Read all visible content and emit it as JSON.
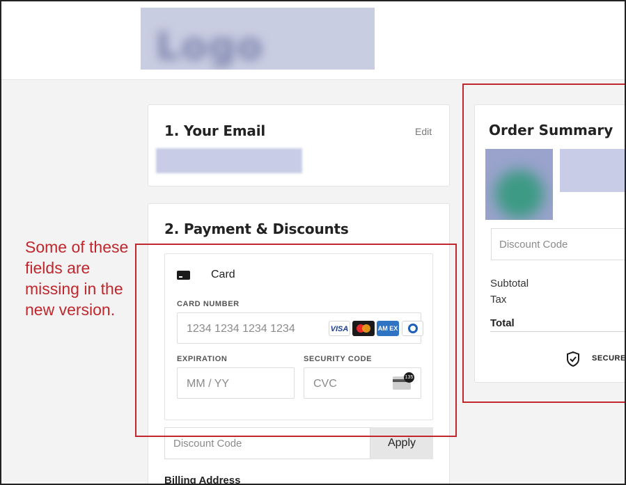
{
  "logo": {
    "text": "Logo"
  },
  "email_section": {
    "title": "1.  Your Email",
    "edit_label": "Edit"
  },
  "payment_section": {
    "title": "2.  Payment & Discounts",
    "method_label": "Card",
    "card_number": {
      "label": "CARD NUMBER",
      "placeholder": "1234 1234 1234 1234"
    },
    "brands": [
      "visa",
      "mastercard",
      "amex",
      "diners"
    ],
    "brand_visa_text": "VISA",
    "brand_amex_text": "AM EX",
    "expiration": {
      "label": "EXPIRATION",
      "placeholder": "MM / YY"
    },
    "security_code": {
      "label": "SECURITY CODE",
      "placeholder": "CVC",
      "badge": "135"
    },
    "discount_placeholder": "Discount Code",
    "apply_label": "Apply",
    "billing_label": "Billing Address"
  },
  "order_summary": {
    "title": "Order Summary",
    "discount_placeholder": "Discount Code",
    "subtotal_label": "Subtotal",
    "tax_label": "Tax",
    "total_label": "Total",
    "secure_label": "SECURE"
  },
  "annotation": {
    "text": "Some of these fields are missing in the new version.",
    "color": "#c0272d"
  }
}
